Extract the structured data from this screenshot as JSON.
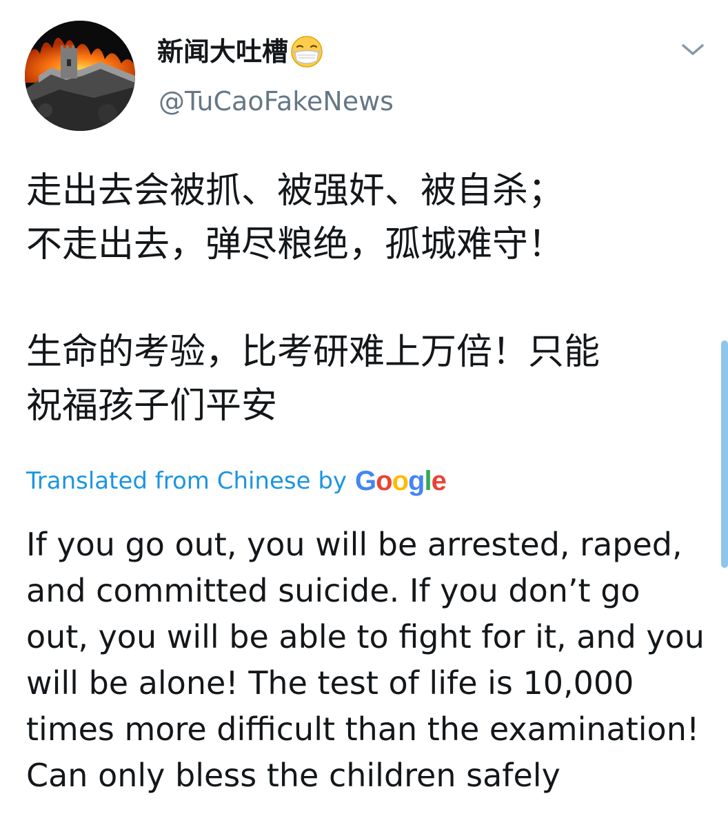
{
  "author": {
    "display_name": "新闻大吐槽",
    "name_emoji": "face-with-medical-mask",
    "handle": "@TuCaoFakeNews"
  },
  "menu_icon": "chevron-down-icon",
  "tweet": {
    "original_lines": [
      "走出去会被抓、被强奸、被自杀；",
      "不走出去，弹尽粮绝，孤城难守！",
      "",
      "生命的考验，比考研难上万倍！只能",
      "祝福孩子们平安"
    ],
    "translated_by_label": "Translated from Chinese by",
    "translator_logo": "Google",
    "translated_lines": [
      "If you go out, you will be arrested, raped,",
      "and committed suicide. If you don’t go",
      "out, you will be able to fight for it, and you",
      "will be alone! The test of life is 10,000",
      "times more difficult than the examination!",
      "Can only bless the children safely"
    ]
  },
  "colors": {
    "link_blue": "#1b95e0",
    "handle_gray": "#657786",
    "text": "#14171a",
    "scrollbar": "#8ec5ea"
  }
}
